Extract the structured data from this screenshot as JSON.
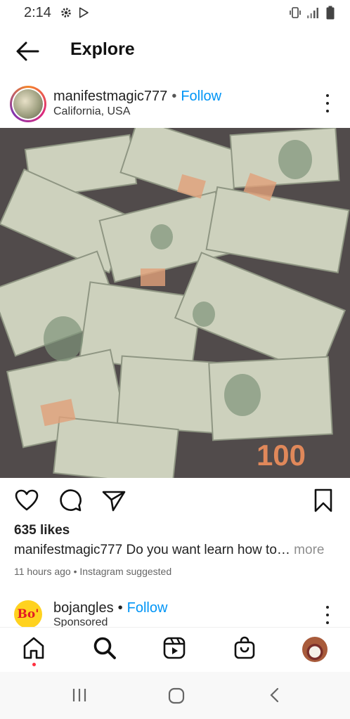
{
  "status_bar": {
    "time": "2:14"
  },
  "header": {
    "title": "Explore"
  },
  "post": {
    "username": "manifestmagic777",
    "separator": "•",
    "follow_label": "Follow",
    "location": "California, USA",
    "likes": "635 likes",
    "caption_user": "manifestmagic777",
    "caption_text": "Do you want learn how to…",
    "caption_more": "more",
    "meta": "11 hours ago • Instagram suggested",
    "image_label": "100"
  },
  "ad": {
    "logo_text": "Bo'",
    "username": "bojangles",
    "separator": "•",
    "follow_label": "Follow",
    "sponsored": "Sponsored"
  },
  "colors": {
    "link": "#0095f6",
    "text": "#262626",
    "muted": "#8e8e8e",
    "notify": "#ff3040"
  },
  "icons": [
    "settings-icon",
    "play-store-icon",
    "vibrate-icon",
    "signal-icon",
    "battery-icon",
    "back-arrow-icon",
    "more-options-icon",
    "heart-icon",
    "comment-icon",
    "share-icon",
    "bookmark-icon",
    "home-icon",
    "search-icon",
    "reels-icon",
    "shop-icon",
    "recent-apps-icon",
    "home-nav-icon",
    "back-nav-icon"
  ]
}
